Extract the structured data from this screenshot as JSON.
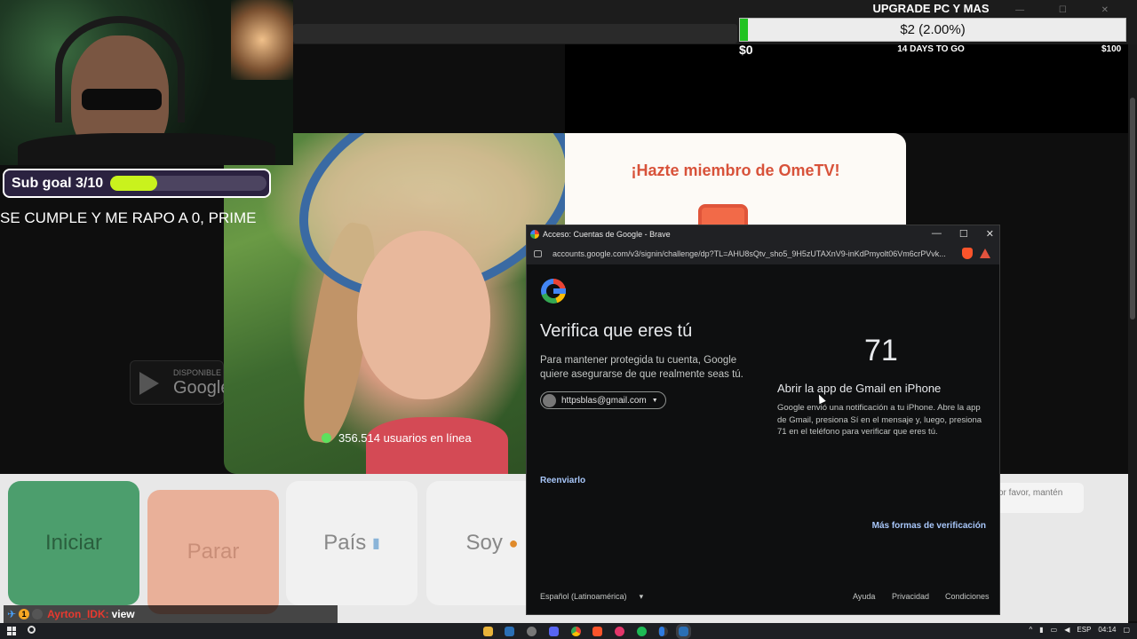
{
  "stream_overlay": {
    "sub_goal_label": "Sub goal 3/10",
    "sub_goal_progress": 0.3,
    "sub_goal_caption": "SE CUMPLE Y ME RAPO A 0, PRIME",
    "donation_title": "UPGRADE PC Y MAS",
    "donation_amount": "$2 (2.00%)",
    "donation_progress_percent": 2,
    "donation_min": "$0",
    "donation_days": "14 DAYS TO GO",
    "donation_max": "$100"
  },
  "ometv": {
    "users_online": "356.514 usuarios en línea",
    "promo_title": "¡Hazte miembro de OmeTV!",
    "gplay_small": "DISPONIBLE",
    "gplay_big": "Google",
    "buttons": {
      "start": "Iniciar",
      "stop": "Parar",
      "country": "País",
      "gender": "Soy"
    },
    "right_hint": "or favor, mantén"
  },
  "chat": {
    "user": "Ayrton_IDK:",
    "message": "view",
    "badge": "1"
  },
  "popup": {
    "window_title": "Acceso: Cuentas de Google - Brave",
    "url": "accounts.google.com/v3/signin/challenge/dp?TL=AHU8sQtv_sho5_9H5zUTAXnV9-inKdPmyolt06Vm6crPVvk...",
    "heading": "Verifica que eres tú",
    "description": "Para mantener protegida tu cuenta, Google quiere asegurarse de que realmente seas tú.",
    "account_email": "httpsblas@gmail.com",
    "number": "71",
    "gmail_title": "Abrir la app de Gmail en iPhone",
    "gmail_desc": "Google envió una notificación a tu iPhone. Abre la app de Gmail, presiona Sí en el mensaje y, luego, presiona 71 en el teléfono para verificar que eres tú.",
    "resend": "Reenviarlo",
    "more_ways": "Más formas de verificación",
    "language": "Español (Latinoamérica)",
    "help": "Ayuda",
    "privacy": "Privacidad",
    "terms": "Condiciones",
    "minimize": "—",
    "maximize": "☐",
    "close": "✕"
  },
  "taskbar": {
    "language": "ESP",
    "time": "04:14"
  },
  "colors": {
    "goal_fill": "#c9f21d",
    "donation_fill": "#22c322",
    "link_blue": "#a8c7fa",
    "promo_red": "#d8523a"
  }
}
